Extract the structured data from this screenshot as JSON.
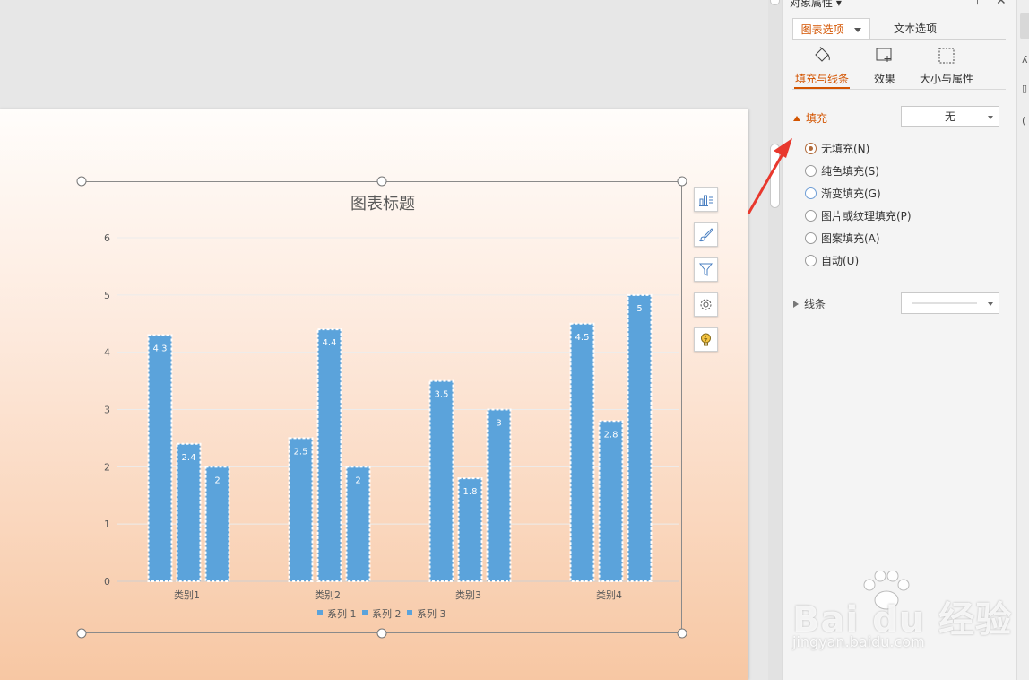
{
  "pane": {
    "title": "对象属性 ▾",
    "top_tabs": {
      "chart_options": "图表选项",
      "text_options": "文本选项"
    },
    "sub_tabs": {
      "fill_line": "填充与线条",
      "effect": "效果",
      "size_props": "大小与属性"
    },
    "fill": {
      "heading": "填充",
      "dropdown_value": "无",
      "options": [
        {
          "label": "无填充(N)",
          "checked": true
        },
        {
          "label": "纯色填充(S)",
          "checked": false
        },
        {
          "label": "渐变填充(G)",
          "checked": false
        },
        {
          "label": "图片或纹理填充(P)",
          "checked": false
        },
        {
          "label": "图案填充(A)",
          "checked": false
        },
        {
          "label": "自动(U)",
          "checked": false
        }
      ]
    },
    "line": {
      "heading": "线条"
    }
  },
  "chart_tools": [
    "chart-elements-icon",
    "chart-style-brush-icon",
    "chart-filter-icon",
    "chart-settings-gear-icon",
    "chart-ideas-bulb-icon"
  ],
  "watermark": {
    "main": "Bai du 经验",
    "url": "jingyan.baidu.com"
  },
  "colors": {
    "accent": "#d35400",
    "bar": "#5ba3db",
    "arrow": "#e8382d"
  },
  "chart_data": {
    "type": "bar",
    "title": "图表标题",
    "categories": [
      "类别1",
      "类别2",
      "类别3",
      "类别4"
    ],
    "series": [
      {
        "name": "系列 1",
        "values": [
          4.3,
          2.5,
          3.5,
          4.5
        ]
      },
      {
        "name": "系列 2",
        "values": [
          2.4,
          4.4,
          1.8,
          2.8
        ]
      },
      {
        "name": "系列 3",
        "values": [
          2,
          2,
          3,
          5
        ]
      }
    ],
    "ylim": [
      0,
      6
    ],
    "yticks": [
      0,
      1,
      2,
      3,
      4,
      5,
      6
    ],
    "grid": true,
    "legend": "bottom",
    "data_labels": true
  }
}
